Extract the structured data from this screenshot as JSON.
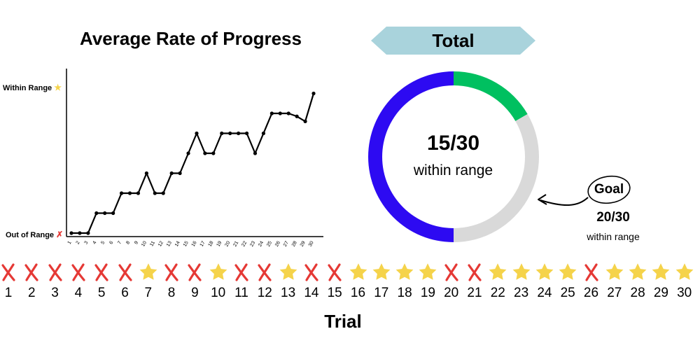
{
  "chart_data": [
    {
      "type": "line",
      "title": "Average Rate of Progress",
      "xlabel": "",
      "ylabel": "",
      "x": [
        1,
        2,
        3,
        4,
        5,
        6,
        7,
        8,
        9,
        10,
        11,
        12,
        13,
        14,
        15,
        16,
        17,
        18,
        19,
        20,
        21,
        22,
        23,
        24,
        25,
        26,
        27,
        28,
        29,
        30
      ],
      "values": [
        0,
        0,
        0,
        1,
        1,
        1,
        2,
        2,
        2,
        3,
        2,
        2,
        3,
        3,
        4,
        5,
        4,
        4,
        5,
        5,
        5,
        5,
        4,
        5,
        6,
        6,
        6,
        5.85,
        5.6,
        7
      ],
      "ylim": [
        0,
        8
      ],
      "y_tick_labels": [
        "Out of Range",
        "Within Range"
      ],
      "y_tick_markers": [
        "✗",
        "★"
      ],
      "grid": false
    },
    {
      "type": "pie",
      "title": "Total",
      "center_value": "15/30",
      "center_caption": "within range",
      "slices": [
        {
          "value": 15,
          "color": "#2d0af2"
        },
        {
          "value": 5,
          "color": "#00c060"
        },
        {
          "value": 10,
          "color": "#d9d9d9"
        }
      ]
    }
  ],
  "goal": {
    "label": "Goal",
    "value": "20/30",
    "caption": "within range"
  },
  "trials": {
    "title": "Trial",
    "outcomes": [
      "x",
      "x",
      "x",
      "x",
      "x",
      "x",
      "star",
      "x",
      "x",
      "star",
      "x",
      "x",
      "star",
      "x",
      "x",
      "star",
      "star",
      "star",
      "star",
      "x",
      "x",
      "star",
      "star",
      "star",
      "star",
      "x",
      "star",
      "star",
      "star",
      "star"
    ],
    "numbers": [
      "1",
      "2",
      "3",
      "4",
      "5",
      "6",
      "7",
      "8",
      "9",
      "10",
      "11",
      "12",
      "13",
      "14",
      "15",
      "16",
      "17",
      "18",
      "19",
      "20",
      "21",
      "22",
      "23",
      "24",
      "25",
      "26",
      "27",
      "28",
      "29",
      "30"
    ]
  },
  "colors": {
    "banner": "#a9d3dc",
    "cross": "#e53935",
    "star": "#f5d34a",
    "within": "#2d0af2",
    "goal": "#00c060",
    "remaining": "#d9d9d9"
  }
}
